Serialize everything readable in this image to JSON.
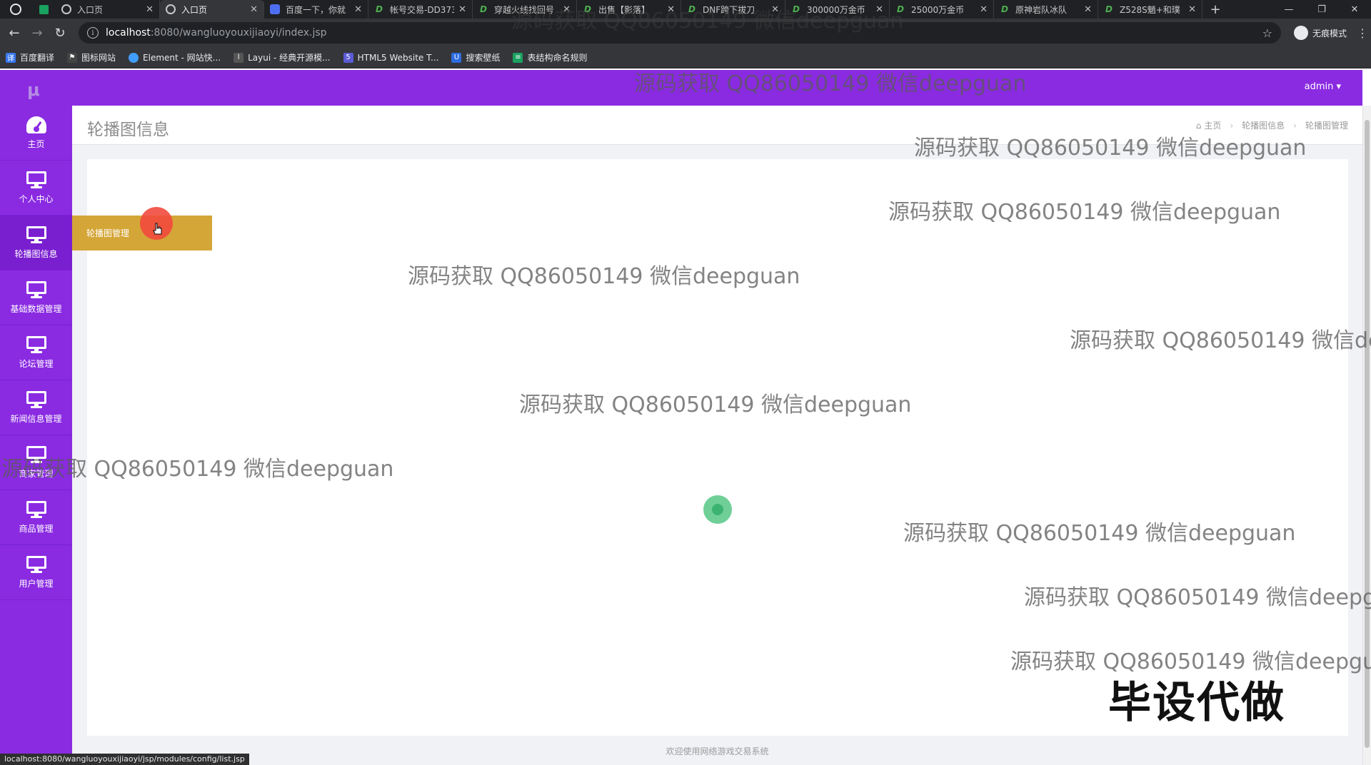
{
  "browser": {
    "tabs": [
      {
        "title": "入口页",
        "icon": "globe-icon",
        "active": false
      },
      {
        "title": "入口页",
        "icon": "globe-icon",
        "active": true
      },
      {
        "title": "百度一下，你就",
        "icon": "baidu-icon",
        "active": false
      },
      {
        "title": "帐号交易-DD373",
        "icon": "dd373-icon",
        "active": false
      },
      {
        "title": "穿越火线找回号",
        "icon": "dd373-icon",
        "active": false
      },
      {
        "title": "出售【影落】",
        "icon": "dd373-icon",
        "active": false
      },
      {
        "title": "DNF跨下拔刀",
        "icon": "dd373-icon",
        "active": false
      },
      {
        "title": "300000万金币",
        "icon": "dd373-icon",
        "active": false
      },
      {
        "title": "25000万金币",
        "icon": "dd373-icon",
        "active": false
      },
      {
        "title": "原神岩队冰队",
        "icon": "dd373-icon",
        "active": false
      },
      {
        "title": "Z528S魈+和璞",
        "icon": "dd373-icon",
        "active": false
      }
    ],
    "url_host": "localhost",
    "url_path": ":8080/wangluoyouxijiaoyi/index.jsp",
    "incognito_label": "无痕模式",
    "bookmarks": [
      {
        "label": "百度翻译",
        "color": "#3a78f2"
      },
      {
        "label": "图标网站",
        "color": "#444444"
      },
      {
        "label": "Element - 网站快...",
        "color": "#409eff"
      },
      {
        "label": "Layui - 经典开源模...",
        "color": "#555555"
      },
      {
        "label": "HTML5 Website T...",
        "color": "#5b5bd6"
      },
      {
        "label": "搜索壁纸",
        "color": "#2d6cdf"
      },
      {
        "label": "表结构命名规则",
        "color": "#1aa260"
      }
    ],
    "status_url": "localhost:8080/wangluoyouxijiaoyi/jsp/modules/config/list.jsp"
  },
  "header": {
    "logo": "μ",
    "user": "admin ▾"
  },
  "sidebar": {
    "items": [
      {
        "label": "主页",
        "icon": "dashboard-icon"
      },
      {
        "label": "个人中心",
        "icon": "monitor-icon"
      },
      {
        "label": "轮播图信息",
        "icon": "monitor-icon"
      },
      {
        "label": "基础数据管理",
        "icon": "monitor-icon"
      },
      {
        "label": "论坛管理",
        "icon": "monitor-icon"
      },
      {
        "label": "新闻信息管理",
        "icon": "monitor-icon"
      },
      {
        "label": "商家管理",
        "icon": "monitor-icon"
      },
      {
        "label": "商品管理",
        "icon": "monitor-icon"
      },
      {
        "label": "用户管理",
        "icon": "monitor-icon"
      }
    ],
    "flyout_label": "轮播图管理"
  },
  "page": {
    "title": "轮播图信息",
    "breadcrumb": [
      "主页",
      "轮播图信息",
      "轮播图管理"
    ],
    "footer": "欢迎使用网络游戏交易系统"
  },
  "watermark": {
    "text": "源码获取 QQ86050149 微信deepguan",
    "badge": "毕设代做"
  },
  "colors": {
    "brand_purple": "#8a2be2",
    "flyout_gold": "#d4a638"
  }
}
